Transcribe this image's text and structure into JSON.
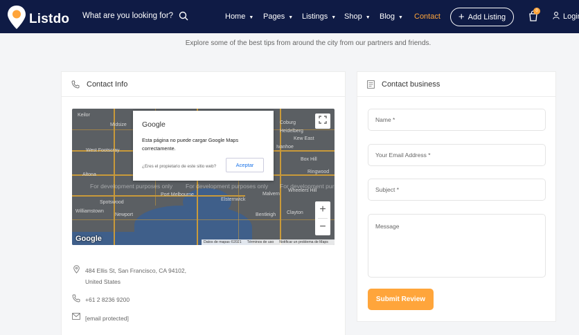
{
  "brand": {
    "name": "Listdo",
    "accent": "#ffa53b",
    "nav_bg": "#0f1b45"
  },
  "nav": {
    "search_text": "What are you looking for?",
    "menu": [
      {
        "label": "Home",
        "has_caret": true
      },
      {
        "label": "Pages",
        "has_caret": true
      },
      {
        "label": "Listings",
        "has_caret": true
      },
      {
        "label": "Shop",
        "has_caret": true
      },
      {
        "label": "Blog",
        "has_caret": true
      },
      {
        "label": "Contact",
        "has_caret": false,
        "active": true
      }
    ],
    "add_listing": "Add Listing",
    "cart_count": "0",
    "login": "Login"
  },
  "subtitle": "Explore some of the best tips from around the city from our partners and friends.",
  "contact_info": {
    "title": "Contact Info",
    "map": {
      "dialog_brand": "Google",
      "dialog_message": "Esta página no puede cargar Google Maps correctamente.",
      "dialog_question": "¿Eres el propietario de este sitio web?",
      "dialog_accept": "Aceptar",
      "dev_text": "For development purposes only",
      "labels": [
        "Keilor",
        "Midsize",
        "Coburg",
        "Heidelberg",
        "Ivanhoe",
        "Kew East",
        "West Footscray",
        "Box Hill",
        "Ringwood",
        "Altona",
        "Spotswood",
        "Williamstown",
        "Port Melbourne",
        "Elsternwick",
        "Bentleigh",
        "Clayton",
        "Wheelers Hill",
        "Newport",
        "Malvern"
      ],
      "google_logo": "Google",
      "footer": [
        "Datos de mapas ©2021",
        "Términos de uso",
        "Notificar un problema de Maps"
      ]
    },
    "address_line1": "484 Ellis St, San Francisco, CA 94102,",
    "address_line2": "United States",
    "phone": "+61 2 8236 9200",
    "email": "[email protected]"
  },
  "contact_business": {
    "title": "Contact business",
    "name_placeholder": "Name *",
    "email_placeholder": "Your Email Address *",
    "subject_placeholder": "Subject *",
    "message_placeholder": "Message",
    "submit": "Submit Review"
  },
  "icons": [
    "logo-pin-icon",
    "search-icon",
    "plus-icon",
    "cart-icon",
    "user-icon",
    "phone-icon",
    "note-icon",
    "fullscreen-icon",
    "location-pin-icon",
    "mail-icon"
  ]
}
